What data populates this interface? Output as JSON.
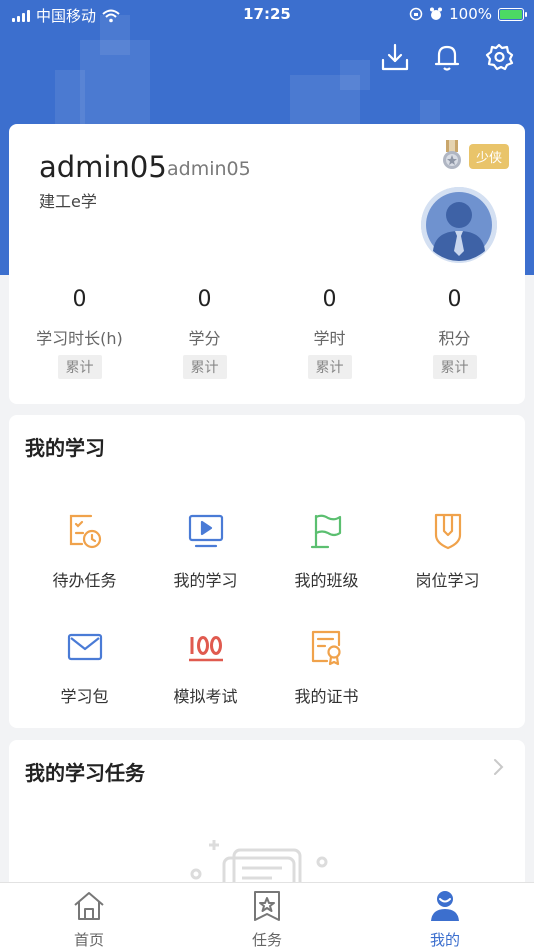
{
  "status_bar": {
    "carrier": "中国移动",
    "time": "17:25",
    "battery": "100%"
  },
  "header": {
    "actions": [
      {
        "icon": "download-icon"
      },
      {
        "icon": "bell-icon"
      },
      {
        "icon": "gear-icon"
      }
    ]
  },
  "profile": {
    "name": "admin05",
    "user_id": "admin05",
    "organization": "建工e学",
    "level_badge": "少侠",
    "stats": [
      {
        "value": "0",
        "label": "学习时长(h)",
        "tag": "累计"
      },
      {
        "value": "0",
        "label": "学分",
        "tag": "累计"
      },
      {
        "value": "0",
        "label": "学时",
        "tag": "累计"
      },
      {
        "value": "0",
        "label": "积分",
        "tag": "累计"
      }
    ]
  },
  "my_study": {
    "title": "我的学习",
    "items": [
      {
        "label": "待办任务",
        "icon": "todo-clock-icon",
        "color": "#f0a24b"
      },
      {
        "label": "我的学习",
        "icon": "video-play-icon",
        "color": "#4a7bd6"
      },
      {
        "label": "我的班级",
        "icon": "flag-icon",
        "color": "#5bbf70"
      },
      {
        "label": "岗位学习",
        "icon": "badge-icon",
        "color": "#f0a24b"
      },
      {
        "label": "学习包",
        "icon": "envelope-icon",
        "color": "#4a7bd6"
      },
      {
        "label": "模拟考试",
        "icon": "score-100-icon",
        "color": "#e05a4f"
      },
      {
        "label": "我的证书",
        "icon": "certificate-icon",
        "color": "#f0a24b"
      }
    ]
  },
  "my_tasks": {
    "title": "我的学习任务"
  },
  "tabbar": {
    "tabs": [
      {
        "label": "首页",
        "icon": "home-icon"
      },
      {
        "label": "任务",
        "icon": "task-star-icon"
      },
      {
        "label": "我的",
        "icon": "profile-icon",
        "active": true
      }
    ]
  },
  "colors": {
    "brand": "#3c6fce",
    "badge": "#e9c46a"
  }
}
